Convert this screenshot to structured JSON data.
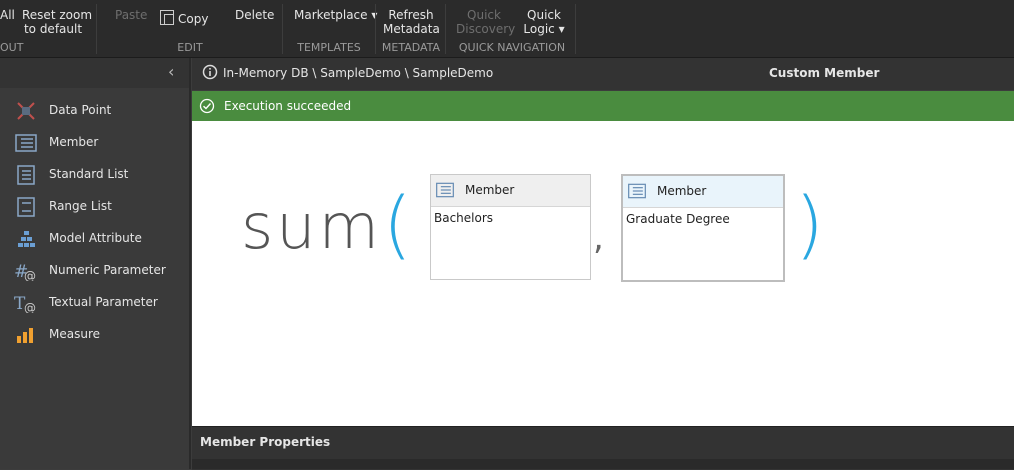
{
  "ribbon": {
    "all_label": "All",
    "reset_zoom_label": "Reset zoom\nto default",
    "layout_group": "OUT",
    "paste_label": "Paste",
    "copy_label": "Copy",
    "delete_label": "Delete",
    "edit_group": "EDIT",
    "marketplace_label": "Marketplace ▾",
    "templates_group": "TEMPLATES",
    "refresh_metadata_label": "Refresh\nMetadata",
    "metadata_group": "METADATA",
    "quick_discovery_label": "Quick\nDiscovery",
    "quick_logic_label": "Quick\nLogic ▾",
    "quick_nav_group": "QUICK NAVIGATION"
  },
  "sidebar": {
    "collapse_glyph": "‹",
    "items": [
      {
        "label": "Data Point",
        "icon": "data-point-icon"
      },
      {
        "label": "Member",
        "icon": "member-icon"
      },
      {
        "label": "Standard List",
        "icon": "standard-list-icon"
      },
      {
        "label": "Range List",
        "icon": "range-list-icon"
      },
      {
        "label": "Model Attribute",
        "icon": "model-attribute-icon"
      },
      {
        "label": "Numeric Parameter",
        "icon": "numeric-parameter-icon"
      },
      {
        "label": "Textual Parameter",
        "icon": "textual-parameter-icon"
      },
      {
        "label": "Measure",
        "icon": "measure-icon"
      }
    ]
  },
  "header": {
    "path": "In-Memory DB \\ SampleDemo \\ SampleDemo",
    "panel_title": "Custom Member"
  },
  "status": {
    "message": "Execution succeeded",
    "color": "#4a8c3f"
  },
  "formula": {
    "function_name": "sum",
    "open_paren": "(",
    "separator": ",",
    "close_paren": ")",
    "args": [
      {
        "title": "Member",
        "value": "Bachelors"
      },
      {
        "title": "Member",
        "value": "Graduate Degree"
      }
    ]
  },
  "properties": {
    "title": "Member Properties"
  }
}
